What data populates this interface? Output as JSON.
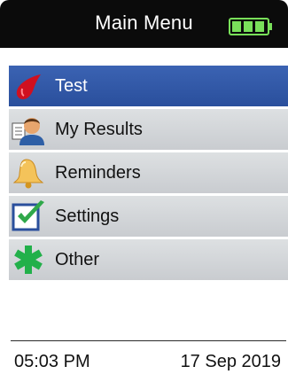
{
  "header": {
    "title": "Main Menu",
    "battery_level": 1.0
  },
  "menu": {
    "selected_index": 0,
    "items": [
      {
        "label": "Test",
        "icon": "blood-drop-icon"
      },
      {
        "label": "My Results",
        "icon": "user-results-icon"
      },
      {
        "label": "Reminders",
        "icon": "bell-icon"
      },
      {
        "label": "Settings",
        "icon": "checkbox-icon"
      },
      {
        "label": "Other",
        "icon": "green-star-icon"
      }
    ]
  },
  "footer": {
    "time": "05:03 PM",
    "date": "17 Sep 2019"
  },
  "colors": {
    "header_bg": "#0b0b0b",
    "selected_bg": "#2f57a6",
    "item_bg": "#d4d7da",
    "battery": "#79e05a"
  }
}
